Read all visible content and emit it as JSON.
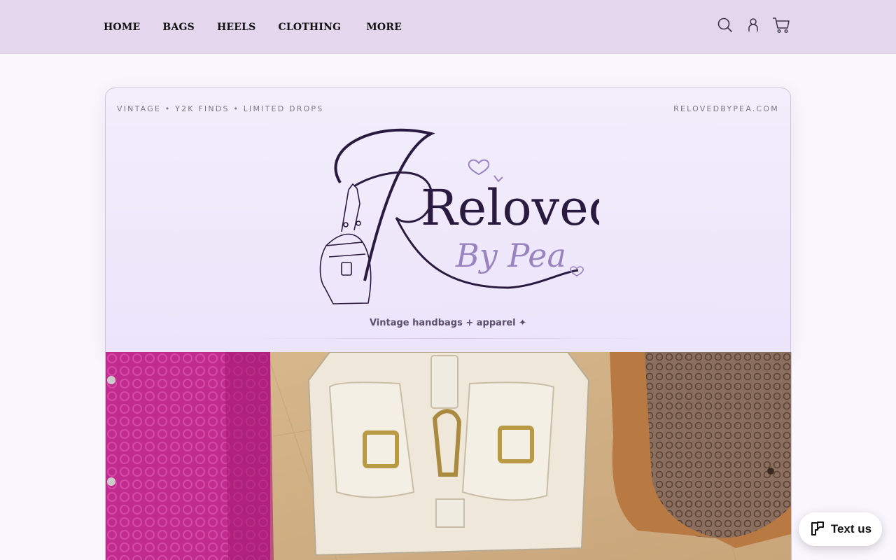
{
  "nav": {
    "items": [
      {
        "label": "HOME"
      },
      {
        "label": "BAGS"
      },
      {
        "label": "HEELS"
      },
      {
        "label": "CLOTHING"
      },
      {
        "label": "MORE"
      }
    ]
  },
  "header_icons": [
    "search-icon",
    "account-icon",
    "cart-icon"
  ],
  "banner": {
    "tagline_left": "VINTAGE • Y2K FINDS • LIMITED DROPS",
    "tagline_right": "RELOVEDBYPEA.COM",
    "logo_main": "Reloved",
    "logo_script": "By Pea",
    "subtitle": "Vintage handbags + apparel ✦"
  },
  "chat_widget": {
    "label": "Text us"
  },
  "colors": {
    "header_bg": "#e3d6ed",
    "logo_dark": "#2a1a40",
    "logo_accent": "#9a84c0"
  }
}
